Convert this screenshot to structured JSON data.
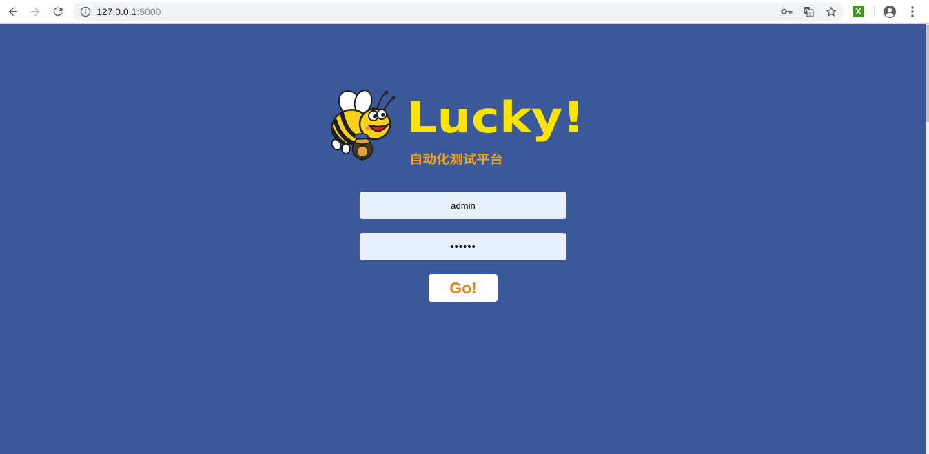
{
  "browser": {
    "url_host": "127.0.0.1",
    "url_port": ":5000",
    "icons": {
      "back": "arrow-left-icon",
      "forward": "arrow-right-icon",
      "reload": "reload-icon",
      "info": "info-icon",
      "password_key": "key-icon",
      "translate": "translate-icon",
      "bookmark": "star-icon",
      "extension": "excel-extension-icon",
      "profile": "account-circle-icon",
      "menu": "three-dot-menu-icon"
    }
  },
  "logo": {
    "wordmark": "Lucky!",
    "tagline": "自动化测试平台",
    "colors": {
      "wordmark": "#ffe400",
      "tagline": "#f4a51c"
    }
  },
  "login": {
    "username_value": "admin",
    "password_value": "123456",
    "submit_label": "Go!"
  },
  "theme": {
    "page_bg": "#3b5998",
    "field_bg": "#e8f0fe",
    "button_bg": "#ffffff",
    "button_text": "#e08a16"
  }
}
